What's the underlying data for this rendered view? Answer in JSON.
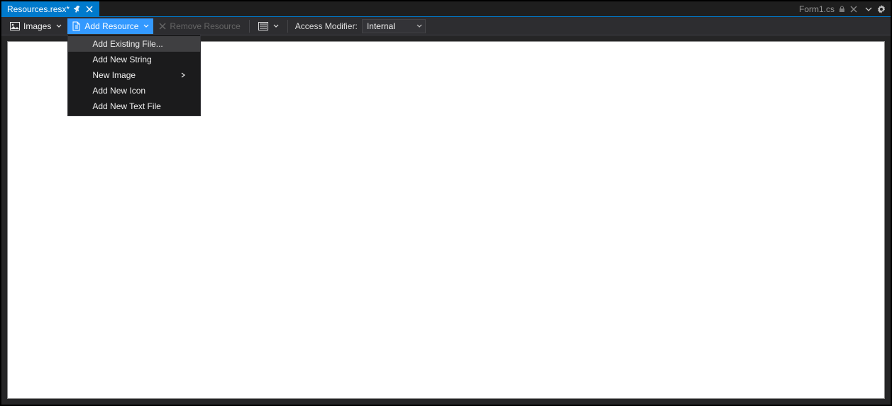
{
  "tabs": {
    "active_label": "Resources.resx*",
    "background_label": "Form1.cs"
  },
  "toolbar": {
    "images_label": "Images",
    "add_resource_label": "Add Resource",
    "remove_resource_label": "Remove Resource",
    "access_modifier_label": "Access Modifier:",
    "access_modifier_value": "Internal"
  },
  "add_resource_menu": {
    "items": [
      "Add Existing File...",
      "Add New String",
      "New Image",
      "Add New Icon",
      "Add New Text File"
    ],
    "submenu_index": 2
  }
}
